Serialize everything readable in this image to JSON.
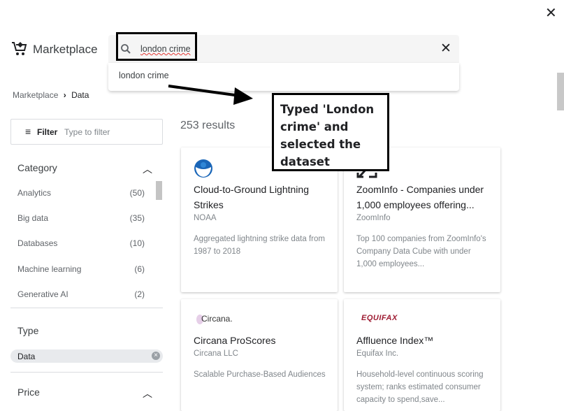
{
  "header": {
    "brand": "Marketplace",
    "search_value": "london crime",
    "suggestion": "london crime"
  },
  "breadcrumb": [
    "Marketplace",
    "Data"
  ],
  "filter": {
    "label": "Filter",
    "placeholder": "Type to filter"
  },
  "category": {
    "title": "Category",
    "items": [
      {
        "label": "Analytics",
        "count": "(50)"
      },
      {
        "label": "Big data",
        "count": "(35)"
      },
      {
        "label": "Databases",
        "count": "(10)"
      },
      {
        "label": "Machine learning",
        "count": "(6)"
      },
      {
        "label": "Generative AI",
        "count": "(2)"
      }
    ]
  },
  "type": {
    "title": "Type",
    "chip": "Data"
  },
  "price": {
    "title": "Price"
  },
  "results": {
    "count": "253 results",
    "cards": [
      {
        "title": "Cloud-to-Ground Lightning Strikes",
        "provider": "NOAA",
        "desc": "Aggregated lightning strike data from 1987 to 2018",
        "logo": "NOAA"
      },
      {
        "title": "ZoomInfo - Companies under 1,000 employees offering...",
        "provider": "ZoomInfo",
        "desc": "Top 100 companies from ZoomInfo's Company Data Cube with under 1,000 employees...",
        "logo": "zoominfo-icon"
      },
      {
        "title": "Circana ProScores",
        "provider": "Circana LLC",
        "desc": "Scalable Purchase-Based Audiences",
        "logo": "Circana."
      },
      {
        "title": "Affluence Index™",
        "provider": "Equifax Inc.",
        "desc": "Household-level continuous scoring system; ranks estimated consumer capacity to spend,save...",
        "logo": "EQUIFAX"
      }
    ]
  },
  "annotation": "Typed 'London crime' and selected the dataset",
  "colors": {
    "equifax": "#9e1b32",
    "noaa": "#1a66b8"
  }
}
